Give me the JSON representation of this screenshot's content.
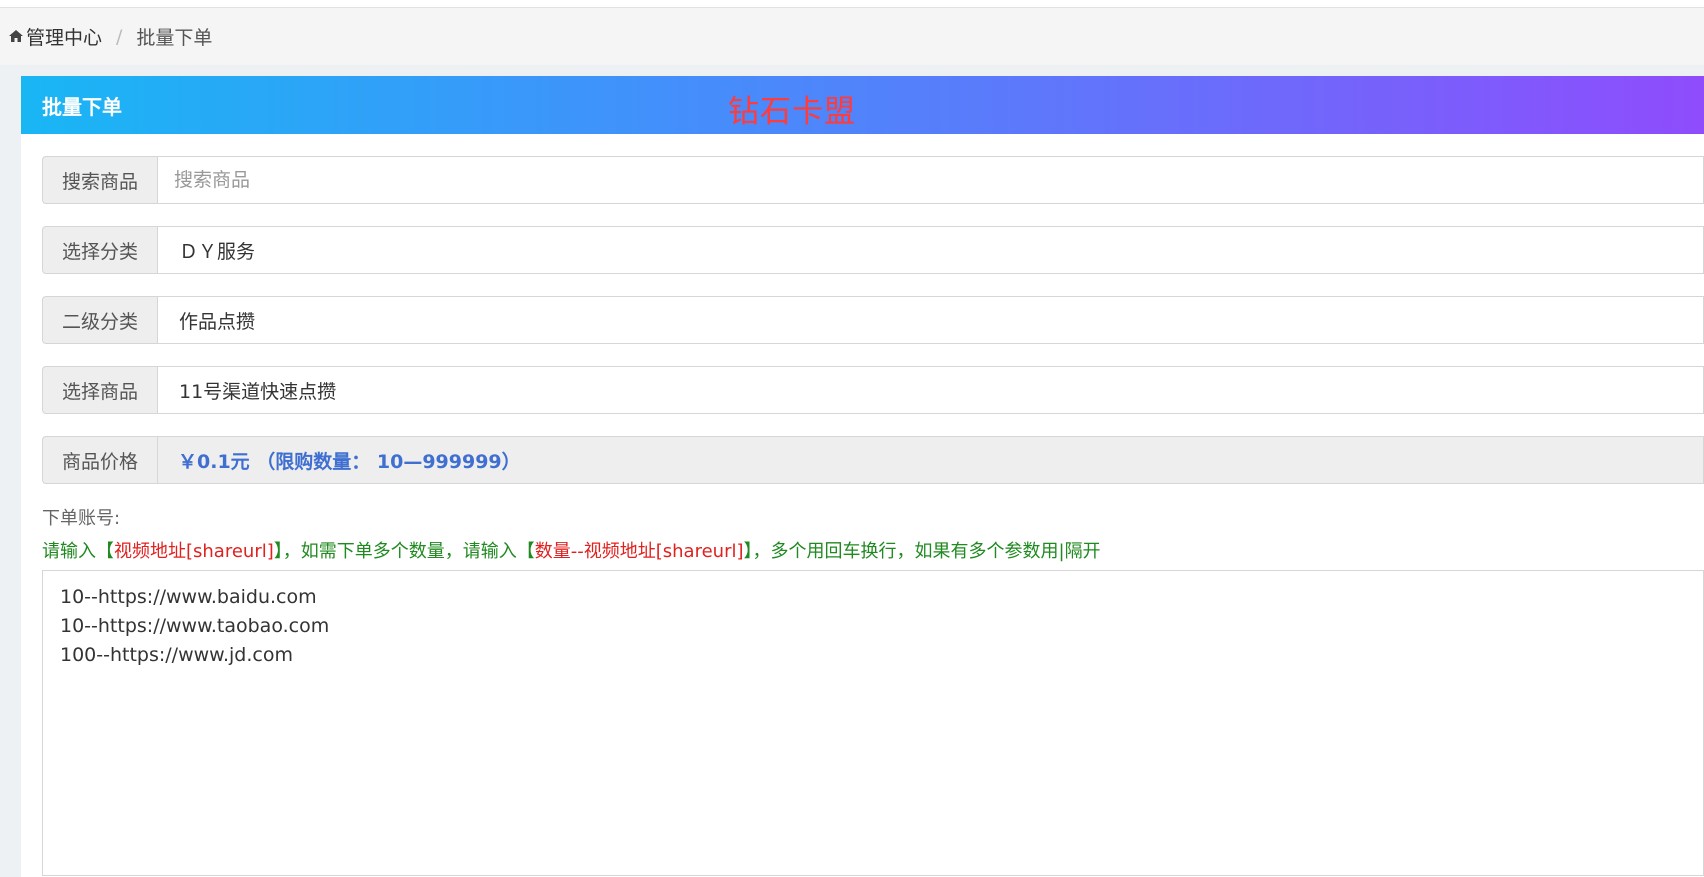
{
  "breadcrumb": {
    "home_label": "管理中心",
    "separator": "/",
    "current": "批量下单"
  },
  "panel": {
    "title": "批量下单",
    "brand": "钻石卡盟"
  },
  "form": {
    "search": {
      "label": "搜索商品",
      "placeholder": "搜索商品",
      "value": ""
    },
    "category": {
      "label": "选择分类",
      "value": "ＤＹ服务"
    },
    "subcategory": {
      "label": "二级分类",
      "value": "作品点攒"
    },
    "product": {
      "label": "选择商品",
      "value": "11号渠道快速点攒"
    },
    "price": {
      "label": "商品价格",
      "value": "￥0.1元 （限购数量： 10—999999）"
    },
    "account": {
      "label": "下单账号:",
      "hint_parts": {
        "p1": "请输入【",
        "r1": "视频地址[shareurl]",
        "p2": "】，如需下单多个数量，请输入【",
        "r2": "数量--视频地址[shareurl]",
        "p3": "】，多个用回车换行，如果有多个参数用|隔开"
      },
      "value": "10--https://www.baidu.com\n10--https://www.taobao.com\n100--https://www.jd.com"
    }
  },
  "icons": {
    "home": "home-icon"
  },
  "colors": {
    "header_gradient_start": "#19b6f4",
    "header_gradient_end": "#8f4cfc",
    "brand": "#ff3b3b",
    "hint_green": "#1f8a1f",
    "hint_red": "#e0211f",
    "price_blue": "#3f6fd1"
  }
}
